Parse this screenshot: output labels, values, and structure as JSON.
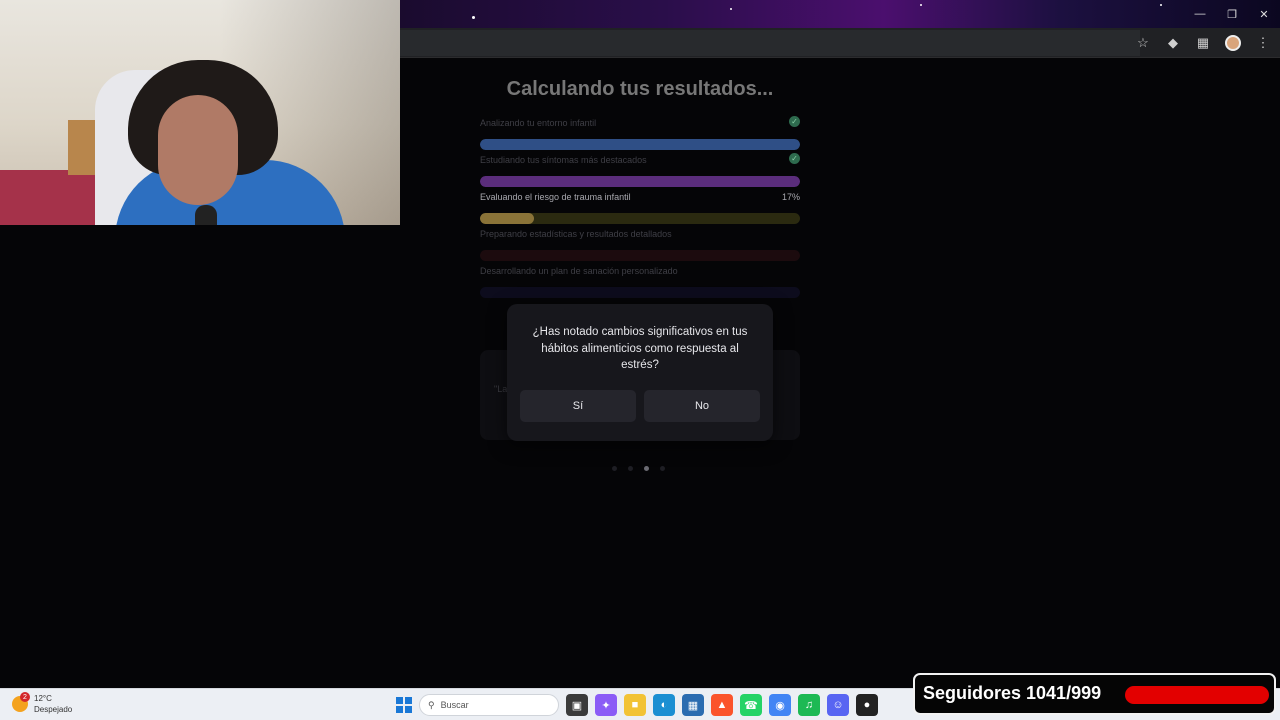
{
  "page": {
    "title": "Calculando tus resultados...",
    "steps": [
      {
        "label": "Analizando tu entorno infantil",
        "status": "done",
        "color": "#2f4f86",
        "progress": 1.0
      },
      {
        "label": "Estudiando tus síntomas más destacados",
        "status": "done",
        "color": "#5b2d7c",
        "progress": 1.0
      },
      {
        "label": "Evaluando el riesgo de trauma infantil",
        "status": "active",
        "percent": "17%",
        "color": "#8a7338",
        "progress": 0.17
      },
      {
        "label": "Preparando estadísticas y resultados detallados",
        "status": "pending",
        "color": "#2a0d12",
        "progress": 0
      },
      {
        "label": "Desarrollando un plan de sanación personalizado",
        "status": "pending",
        "color": "#13122a",
        "progress": 0
      }
    ],
    "quote_snippet": "\"La pe",
    "carousel_active": 2
  },
  "modal": {
    "question": "¿Has notado cambios significativos en tus hábitos alimenticios como respuesta al estrés?",
    "yes_label": "Sí",
    "no_label": "No"
  },
  "taskbar": {
    "temperature": "12°C",
    "weather": "Despejado",
    "weather_badge": "2",
    "search_placeholder": "Buscar"
  },
  "overlay": {
    "followers_text": "Seguidores 1041/999",
    "followers_progress": 1.0
  }
}
